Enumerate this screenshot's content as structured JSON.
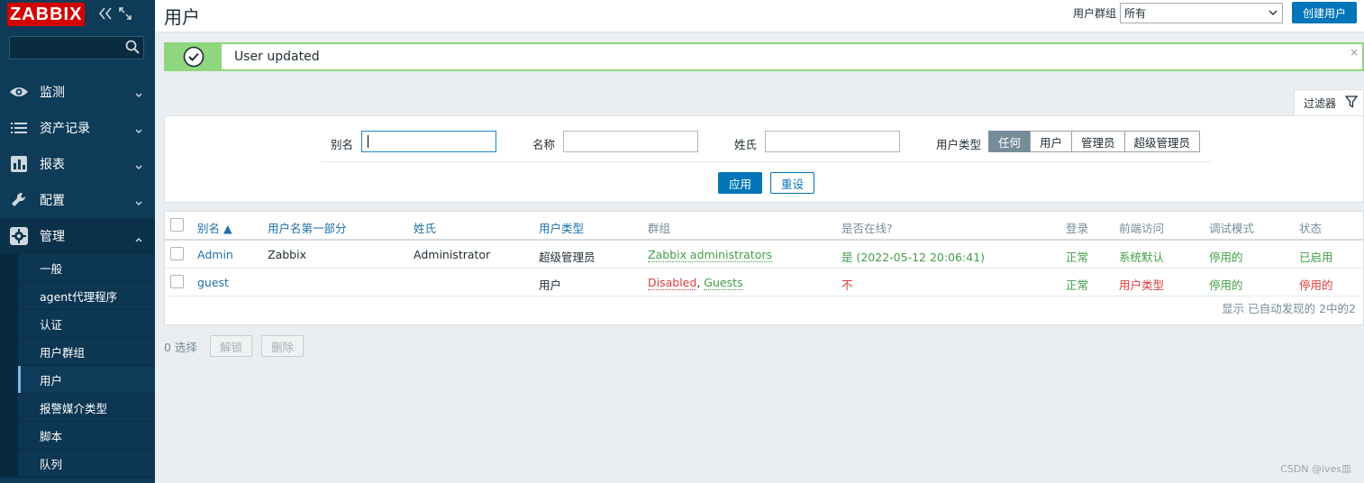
{
  "sidebar": {
    "logo": "ZABBIX",
    "menu": [
      {
        "label": "监测",
        "icon": "eye-icon"
      },
      {
        "label": "资产记录",
        "icon": "list-icon"
      },
      {
        "label": "报表",
        "icon": "bar-chart-icon"
      },
      {
        "label": "配置",
        "icon": "wrench-icon"
      },
      {
        "label": "管理",
        "icon": "gear-icon"
      }
    ],
    "submenu": [
      "一般",
      "agent代理程序",
      "认证",
      "用户群组",
      "用户",
      "报警媒介类型",
      "脚本",
      "队列"
    ],
    "active_submenu": "用户"
  },
  "header": {
    "title": "用户",
    "group_label": "用户群组",
    "group_value": "所有",
    "create_label": "创建用户"
  },
  "message": {
    "text": "User updated",
    "close": "×"
  },
  "filter": {
    "tab_label": "过滤器",
    "alias_label": "别名",
    "alias_value": "",
    "name_label": "名称",
    "name_value": "",
    "surname_label": "姓氏",
    "surname_value": "",
    "type_label": "用户类型",
    "type_options": [
      "任何",
      "用户",
      "管理员",
      "超级管理员"
    ],
    "type_selected": "任何",
    "apply_label": "应用",
    "reset_label": "重设"
  },
  "table": {
    "columns": [
      "别名 ▲",
      "用户名第一部分",
      "姓氏",
      "用户类型",
      "群组",
      "是否在线?",
      "登录",
      "前端访问",
      "调试模式",
      "状态"
    ],
    "rows": [
      {
        "alias": "Admin",
        "name": "Zabbix",
        "surname": "Administrator",
        "type": "超级管理员",
        "groups": [
          {
            "text": "Zabbix administrators",
            "color": "green"
          }
        ],
        "online": "是 (2022-05-12 20:06:41)",
        "online_color": "green",
        "login": "正常",
        "frontend": "系统默认",
        "frontend_color": "green",
        "debug": "停用的",
        "status": "已启用",
        "status_color": "green"
      },
      {
        "alias": "guest",
        "name": "",
        "surname": "",
        "type": "用户",
        "groups": [
          {
            "text": "Disabled",
            "color": "red"
          },
          {
            "text": "Guests",
            "color": "green"
          }
        ],
        "online": "不",
        "online_color": "red",
        "login": "正常",
        "frontend": "用户类型",
        "frontend_color": "red",
        "debug": "停用的",
        "status": "停用的",
        "status_color": "red"
      }
    ],
    "footer": "显示 已自动发现的 2中的2"
  },
  "actions": {
    "selected": "0 选择",
    "unblock": "解锁",
    "delete": "删除"
  },
  "watermark": "CSDN @ives皿"
}
